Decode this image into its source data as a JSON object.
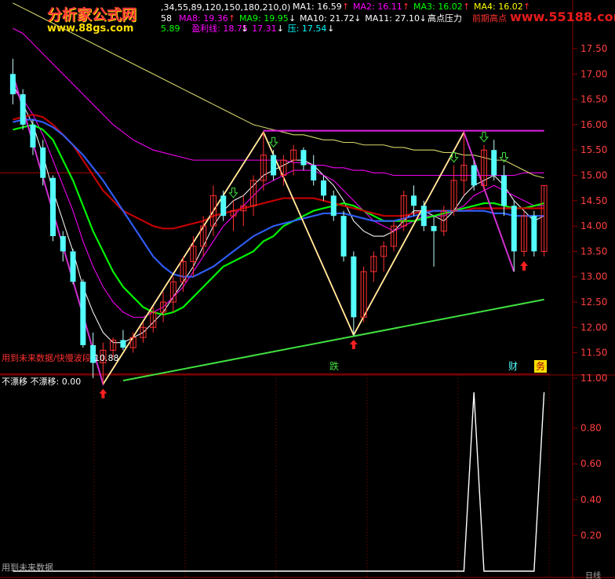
{
  "logo": {
    "name": "分析家公式网",
    "url": "www.88gs.com",
    "right_url": "www.55188.com"
  },
  "header": {
    "params": ",34,55,89,120,150,180,210,0)",
    "row1": [
      {
        "label": "MA1: 16.59",
        "arrow": "↑",
        "color": "#ffffff"
      },
      {
        "label": "MA2: 16.11",
        "arrow": "↑",
        "color": "#ff00ff"
      },
      {
        "label": "MA3: 16.02",
        "arrow": "↑",
        "color": "#00ff00"
      },
      {
        "label": "MA4: 16.02",
        "arrow": "↑",
        "color": "#ffff00"
      }
    ],
    "row2_left": "58",
    "row2": [
      {
        "label": "MA8: 19.36",
        "arrow": "↑",
        "color": "#ff00ff"
      },
      {
        "label": "MA9: 19.95",
        "arrow": "↓",
        "color": "#00ff00"
      },
      {
        "label": "MA10: 21.72",
        "arrow": "↓",
        "color": "#ffffff"
      },
      {
        "label": "MA11: 27.10",
        "arrow": "↓",
        "color": "#ffffff"
      }
    ],
    "row2_extra": "高点压力",
    "row2_extra2": "前期高点",
    "row3": [
      {
        "label": "5.89",
        "arrow": "",
        "color": "#00ff00"
      },
      {
        "label": "盈利线: 18.75",
        "arrow": "↓",
        "color": "#ff00ff"
      },
      {
        "label": "17.31",
        "arrow": "↓",
        "color": "#ff00ff"
      },
      {
        "label": "压: 17.54",
        "arrow": "↓",
        "color": "#00ffff"
      }
    ]
  },
  "price_axis_labels": [
    "17.50",
    "17.00",
    "16.50",
    "16.00",
    "15.50",
    "15.00",
    "14.50",
    "14.00",
    "13.50",
    "13.00",
    "12.50",
    "12.00",
    "11.50",
    "11.00"
  ],
  "markers": {
    "low_label": "10.88",
    "bottom_left_text": "用到未来数据/快慢波段",
    "fall_label": "跌",
    "cai_label": "财",
    "wu_label": "务"
  },
  "sub_panel": {
    "title": "不漂移  不漂移: 0.00",
    "axis_labels": [
      "0.80",
      "0.60",
      "0.40",
      "0.20"
    ],
    "footer": "用到未来数据",
    "corner": "日线"
  },
  "colors": {
    "up": "#ff3030",
    "down": "#54ffff",
    "grid": "#8b0000",
    "axis_text": "#ff4040"
  },
  "chart_data": {
    "type": "candlestick",
    "ylim": [
      10.8,
      17.75
    ],
    "sub_ylim": [
      0,
      1.0
    ],
    "candles": [
      {
        "o": 17.0,
        "h": 17.3,
        "l": 16.4,
        "c": 16.6
      },
      {
        "o": 16.6,
        "h": 16.7,
        "l": 15.9,
        "c": 16.0
      },
      {
        "o": 16.0,
        "h": 16.1,
        "l": 15.4,
        "c": 15.55
      },
      {
        "o": 15.55,
        "h": 15.7,
        "l": 14.8,
        "c": 14.95
      },
      {
        "o": 14.95,
        "h": 15.0,
        "l": 13.7,
        "c": 13.8
      },
      {
        "o": 13.8,
        "h": 13.9,
        "l": 13.3,
        "c": 13.5
      },
      {
        "o": 13.5,
        "h": 13.55,
        "l": 12.85,
        "c": 12.9
      },
      {
        "o": 12.9,
        "h": 12.95,
        "l": 11.6,
        "c": 11.65
      },
      {
        "o": 11.65,
        "h": 11.9,
        "l": 11.0,
        "c": 11.3
      },
      {
        "o": 11.3,
        "h": 11.7,
        "l": 10.88,
        "c": 11.55
      },
      {
        "o": 11.55,
        "h": 11.8,
        "l": 11.4,
        "c": 11.75
      },
      {
        "o": 11.75,
        "h": 11.95,
        "l": 11.55,
        "c": 11.6
      },
      {
        "o": 11.6,
        "h": 11.9,
        "l": 11.5,
        "c": 11.8
      },
      {
        "o": 11.8,
        "h": 12.1,
        "l": 11.7,
        "c": 12.0
      },
      {
        "o": 12.0,
        "h": 12.4,
        "l": 11.9,
        "c": 12.3
      },
      {
        "o": 12.3,
        "h": 12.7,
        "l": 12.1,
        "c": 12.5
      },
      {
        "o": 12.5,
        "h": 13.0,
        "l": 12.3,
        "c": 12.9
      },
      {
        "o": 12.9,
        "h": 13.4,
        "l": 12.7,
        "c": 13.3
      },
      {
        "o": 13.3,
        "h": 13.8,
        "l": 13.0,
        "c": 13.6
      },
      {
        "o": 13.6,
        "h": 14.2,
        "l": 13.4,
        "c": 14.0
      },
      {
        "o": 14.0,
        "h": 14.8,
        "l": 13.8,
        "c": 14.6
      },
      {
        "o": 14.6,
        "h": 14.7,
        "l": 14.1,
        "c": 14.2
      },
      {
        "o": 14.2,
        "h": 14.5,
        "l": 13.9,
        "c": 14.3
      },
      {
        "o": 14.3,
        "h": 14.6,
        "l": 14.0,
        "c": 14.4
      },
      {
        "o": 14.4,
        "h": 15.0,
        "l": 14.2,
        "c": 14.9
      },
      {
        "o": 14.9,
        "h": 15.85,
        "l": 14.7,
        "c": 15.4
      },
      {
        "o": 15.4,
        "h": 15.5,
        "l": 14.9,
        "c": 15.0
      },
      {
        "o": 15.0,
        "h": 15.4,
        "l": 14.8,
        "c": 15.3
      },
      {
        "o": 15.3,
        "h": 15.6,
        "l": 15.0,
        "c": 15.5
      },
      {
        "o": 15.5,
        "h": 15.55,
        "l": 15.1,
        "c": 15.2
      },
      {
        "o": 15.2,
        "h": 15.4,
        "l": 14.8,
        "c": 14.9
      },
      {
        "o": 14.9,
        "h": 15.0,
        "l": 14.5,
        "c": 14.6
      },
      {
        "o": 14.6,
        "h": 14.7,
        "l": 14.1,
        "c": 14.2
      },
      {
        "o": 14.2,
        "h": 14.3,
        "l": 13.3,
        "c": 13.4
      },
      {
        "o": 13.4,
        "h": 13.5,
        "l": 11.85,
        "c": 12.2
      },
      {
        "o": 12.2,
        "h": 13.2,
        "l": 12.1,
        "c": 13.1
      },
      {
        "o": 13.1,
        "h": 13.5,
        "l": 12.9,
        "c": 13.4
      },
      {
        "o": 13.4,
        "h": 13.7,
        "l": 13.1,
        "c": 13.6
      },
      {
        "o": 13.6,
        "h": 14.1,
        "l": 13.5,
        "c": 14.0
      },
      {
        "o": 14.0,
        "h": 14.7,
        "l": 13.9,
        "c": 14.6
      },
      {
        "o": 14.6,
        "h": 14.8,
        "l": 14.2,
        "c": 14.4
      },
      {
        "o": 14.4,
        "h": 14.5,
        "l": 13.9,
        "c": 14.0
      },
      {
        "o": 14.0,
        "h": 14.2,
        "l": 13.2,
        "c": 13.9
      },
      {
        "o": 13.9,
        "h": 14.4,
        "l": 13.8,
        "c": 14.3
      },
      {
        "o": 14.3,
        "h": 15.2,
        "l": 14.2,
        "c": 14.9
      },
      {
        "o": 14.9,
        "h": 15.85,
        "l": 14.6,
        "c": 15.2
      },
      {
        "o": 15.2,
        "h": 15.3,
        "l": 14.7,
        "c": 14.8
      },
      {
        "o": 14.8,
        "h": 15.6,
        "l": 14.7,
        "c": 15.5
      },
      {
        "o": 15.5,
        "h": 15.7,
        "l": 14.9,
        "c": 15.0
      },
      {
        "o": 15.0,
        "h": 15.2,
        "l": 14.2,
        "c": 14.4
      },
      {
        "o": 14.4,
        "h": 14.5,
        "l": 13.1,
        "c": 13.5
      },
      {
        "o": 13.5,
        "h": 14.3,
        "l": 13.4,
        "c": 14.2
      },
      {
        "o": 14.2,
        "h": 14.3,
        "l": 13.4,
        "c": 13.5
      },
      {
        "o": 13.5,
        "h": 14.8,
        "l": 13.4,
        "c": 14.8
      }
    ],
    "zigzag_purple": [
      [
        0,
        17.0
      ],
      [
        9,
        10.88
      ],
      [
        25,
        15.85
      ],
      [
        34,
        11.85
      ],
      [
        45,
        15.85
      ],
      [
        50,
        13.1
      ]
    ],
    "zigzag_yellow": [
      [
        9,
        10.88
      ],
      [
        25,
        15.85
      ],
      [
        34,
        11.85
      ],
      [
        45,
        15.85
      ]
    ],
    "resistance_line": {
      "from": [
        25,
        15.88
      ],
      "to": [
        53,
        15.88
      ]
    },
    "support_line": {
      "from": [
        11,
        10.95
      ],
      "to": [
        53,
        12.55
      ]
    },
    "ma_lines": [
      {
        "color": "#ffffff",
        "values": [
          16.8,
          16.4,
          16.0,
          15.4,
          14.7,
          14.1,
          13.5,
          12.8,
          12.3,
          11.9,
          11.7,
          11.7,
          11.8,
          11.9,
          12.1,
          12.3,
          12.6,
          12.9,
          13.2,
          13.6,
          14.0,
          14.3,
          14.5,
          14.6,
          14.8,
          15.0,
          15.1,
          15.2,
          15.3,
          15.3,
          15.2,
          15.0,
          14.8,
          14.5,
          14.1,
          13.9,
          13.8,
          13.8,
          13.9,
          14.1,
          14.3,
          14.3,
          14.2,
          14.1,
          14.3,
          14.6,
          14.8,
          14.9,
          15.0,
          14.8,
          14.5,
          14.3,
          14.1,
          14.2
        ]
      },
      {
        "color": "#ff00ff",
        "values": [
          16.7,
          16.5,
          16.2,
          15.8,
          15.3,
          14.8,
          14.3,
          13.7,
          13.2,
          12.8,
          12.5,
          12.3,
          12.2,
          12.2,
          12.3,
          12.4,
          12.6,
          12.8,
          13.1,
          13.4,
          13.7,
          14.0,
          14.2,
          14.4,
          14.6,
          14.8,
          14.9,
          15.0,
          15.1,
          15.1,
          15.1,
          15.0,
          14.9,
          14.7,
          14.5,
          14.3,
          14.1,
          14.0,
          13.9,
          14.0,
          14.1,
          14.2,
          14.2,
          14.2,
          14.3,
          14.4,
          14.6,
          14.7,
          14.8,
          14.7,
          14.6,
          14.5,
          14.4,
          14.4
        ]
      },
      {
        "color": "#00ff00",
        "values": [
          15.9,
          15.95,
          16.0,
          15.9,
          15.7,
          15.3,
          14.9,
          14.4,
          13.9,
          13.5,
          13.1,
          12.8,
          12.6,
          12.4,
          12.3,
          12.25,
          12.3,
          12.4,
          12.6,
          12.8,
          13.0,
          13.2,
          13.3,
          13.4,
          13.5,
          13.7,
          13.8,
          14.0,
          14.1,
          14.2,
          14.3,
          14.35,
          14.4,
          14.45,
          14.4,
          14.3,
          14.2,
          14.1,
          14.1,
          14.1,
          14.1,
          14.15,
          14.2,
          14.25,
          14.3,
          14.35,
          14.4,
          14.45,
          14.45,
          14.4,
          14.35,
          14.35,
          14.4,
          14.45
        ]
      },
      {
        "color": "#cc0000",
        "values": [
          16.1,
          16.15,
          16.2,
          16.15,
          16.0,
          15.8,
          15.6,
          15.3,
          15.0,
          14.7,
          14.5,
          14.3,
          14.2,
          14.1,
          14.0,
          13.95,
          13.95,
          14.0,
          14.05,
          14.1,
          14.2,
          14.25,
          14.3,
          14.35,
          14.4,
          14.45,
          14.5,
          14.55,
          14.55,
          14.55,
          14.55,
          14.5,
          14.45,
          14.4,
          14.35,
          14.3,
          14.25,
          14.2,
          14.2,
          14.2,
          14.25,
          14.3,
          14.3,
          14.3,
          14.3,
          14.3,
          14.35,
          14.35,
          14.35,
          14.35,
          14.35,
          14.35,
          14.35,
          14.35
        ]
      },
      {
        "color": "#3060ff",
        "values": [
          16.05,
          16.1,
          16.1,
          16.05,
          15.95,
          15.8,
          15.6,
          15.4,
          15.15,
          14.9,
          14.6,
          14.3,
          14.0,
          13.7,
          13.4,
          13.2,
          13.05,
          13.0,
          13.0,
          13.1,
          13.2,
          13.35,
          13.5,
          13.65,
          13.8,
          13.9,
          14.0,
          14.05,
          14.1,
          14.15,
          14.2,
          14.25,
          14.25,
          14.25,
          14.2,
          14.15,
          14.1,
          14.1,
          14.1,
          14.15,
          14.2,
          14.25,
          14.3,
          14.3,
          14.3,
          14.3,
          14.3,
          14.3,
          14.25,
          14.25,
          14.2,
          14.2,
          14.2,
          14.2
        ]
      },
      {
        "color": "#ff00ff",
        "values": [
          17.9,
          17.8,
          17.6,
          17.4,
          17.2,
          17.0,
          16.8,
          16.6,
          16.4,
          16.2,
          16.0,
          15.85,
          15.7,
          15.6,
          15.5,
          15.45,
          15.4,
          15.35,
          15.3,
          15.3,
          15.3,
          15.3,
          15.3,
          15.3,
          15.3,
          15.3,
          15.3,
          15.3,
          15.25,
          15.25,
          15.2,
          15.2,
          15.15,
          15.15,
          15.1,
          15.1,
          15.05,
          15.05,
          15.0,
          15.0,
          15.0,
          15.0,
          15.0,
          15.0,
          15.0,
          15.0,
          15.0,
          15.0,
          15.0,
          15.0,
          15.0,
          15.05,
          15.05,
          15.05
        ]
      },
      {
        "color": "#e0e070",
        "values": [
          18.4,
          18.3,
          18.2,
          18.1,
          18.0,
          17.9,
          17.8,
          17.7,
          17.6,
          17.5,
          17.4,
          17.3,
          17.2,
          17.1,
          17.0,
          16.9,
          16.8,
          16.7,
          16.6,
          16.5,
          16.4,
          16.3,
          16.2,
          16.1,
          16.0,
          15.95,
          15.9,
          15.85,
          15.8,
          15.8,
          15.75,
          15.7,
          15.7,
          15.65,
          15.65,
          15.6,
          15.6,
          15.6,
          15.55,
          15.55,
          15.5,
          15.5,
          15.5,
          15.45,
          15.45,
          15.4,
          15.4,
          15.35,
          15.3,
          15.3,
          15.2,
          15.1,
          15.0,
          14.95
        ]
      }
    ],
    "sub_series": {
      "points": [
        [
          0,
          0
        ],
        [
          45,
          0
        ],
        [
          46,
          1.0
        ],
        [
          47,
          0
        ],
        [
          52,
          0
        ],
        [
          53,
          1.0
        ]
      ]
    }
  }
}
